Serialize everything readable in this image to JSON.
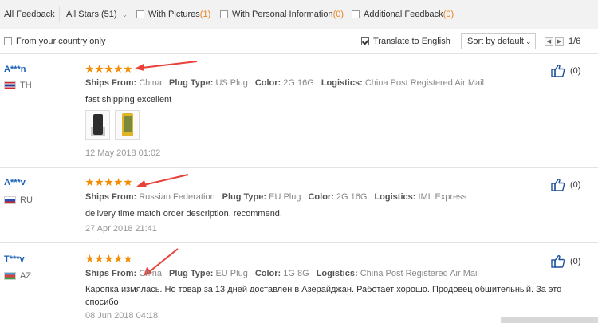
{
  "filters": {
    "all_feedback": "All Feedback",
    "all_stars": "All Stars (51)",
    "with_pictures": {
      "label": "With Pictures ",
      "count": "(1)"
    },
    "with_personal_info": {
      "label": "With Personal Information",
      "count": "(0)"
    },
    "additional_feedback": {
      "label": "Additional Feedback ",
      "count": "(0)"
    }
  },
  "options": {
    "from_country": "From your country only",
    "translate": "Translate to English",
    "sort": "Sort by default",
    "pager_prev": "◀",
    "pager_next": "▶",
    "page": "1/6"
  },
  "labels": {
    "ships_from": "Ships From:",
    "plug_type": "Plug Type:",
    "color": "Color:",
    "logistics": "Logistics:"
  },
  "reviews": [
    {
      "user": "A***n",
      "country": "TH",
      "stars": 5,
      "ships_from": "China",
      "plug_type": "US Plug",
      "color": "2G 16G",
      "logistics": "China Post Registered Air Mail",
      "text": "fast shipping excellent",
      "date": "12 May 2018 01:02",
      "likes": "(0)"
    },
    {
      "user": "A***v",
      "country": "RU",
      "stars": 5,
      "ships_from": "Russian Federation",
      "plug_type": "EU Plug",
      "color": "2G 16G",
      "logistics": "IML Express",
      "text": "delivery time match order description, recommend.",
      "date": "27 Apr 2018 21:41",
      "likes": "(0)"
    },
    {
      "user": "T***v",
      "country": "AZ",
      "stars": 5,
      "ships_from": "China",
      "plug_type": "EU Plug",
      "color": "1G 8G",
      "logistics": "China Post Registered Air Mail",
      "text": "Каропка измялась. Но товар за 13 дней доставлен в Азерайджан. Работает хорошо. Продовец обшительный. За это спосибо",
      "date": "08 Jun 2018 04:18",
      "likes": "(0)"
    }
  ],
  "colors": {
    "star": "#f28c00",
    "count": "#e8851e",
    "username": "#1a5fb4",
    "arrow": "#e8403a",
    "filter_bg": "#f2f2f2"
  }
}
